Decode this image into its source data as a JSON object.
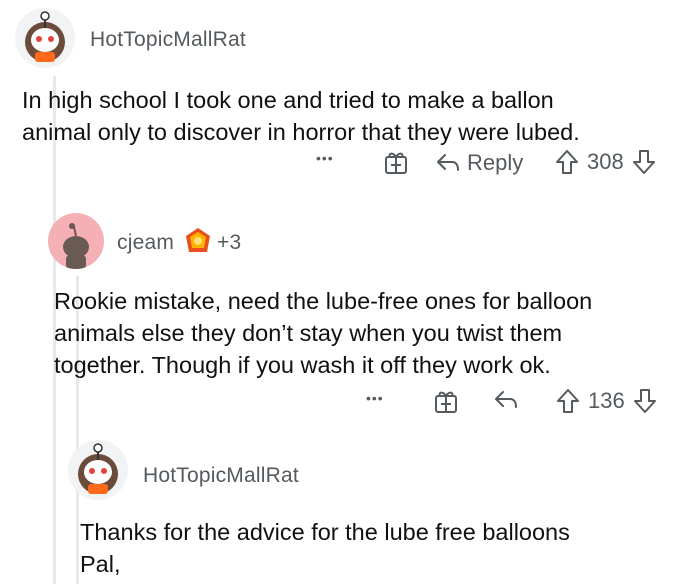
{
  "comments": [
    {
      "username": "HotTopicMallRat",
      "text_lines": [
        "In high school I took one and tried to make a ballon",
        "animal only to discover in horror that they were lubed."
      ],
      "actions": {
        "more": "•••",
        "reply": "Reply",
        "score": "308"
      }
    },
    {
      "username": "cjeam",
      "award_extra": "+3",
      "text_lines": [
        "Rookie mistake, need the lube-free ones for balloon",
        "animals else they don’t stay when you twist them",
        "together. Though if you wash it off they work ok."
      ],
      "actions": {
        "more": "•••",
        "score": "136"
      }
    },
    {
      "username": "HotTopicMallRat",
      "text_lines": [
        "Thanks for the advice for the lube free balloons",
        "Pal,"
      ]
    }
  ],
  "icons": {
    "upvote": "arrow-up-outline",
    "downvote": "arrow-down-outline",
    "reply": "reply-arrow",
    "award": "gift-box",
    "more": "ellipsis"
  }
}
